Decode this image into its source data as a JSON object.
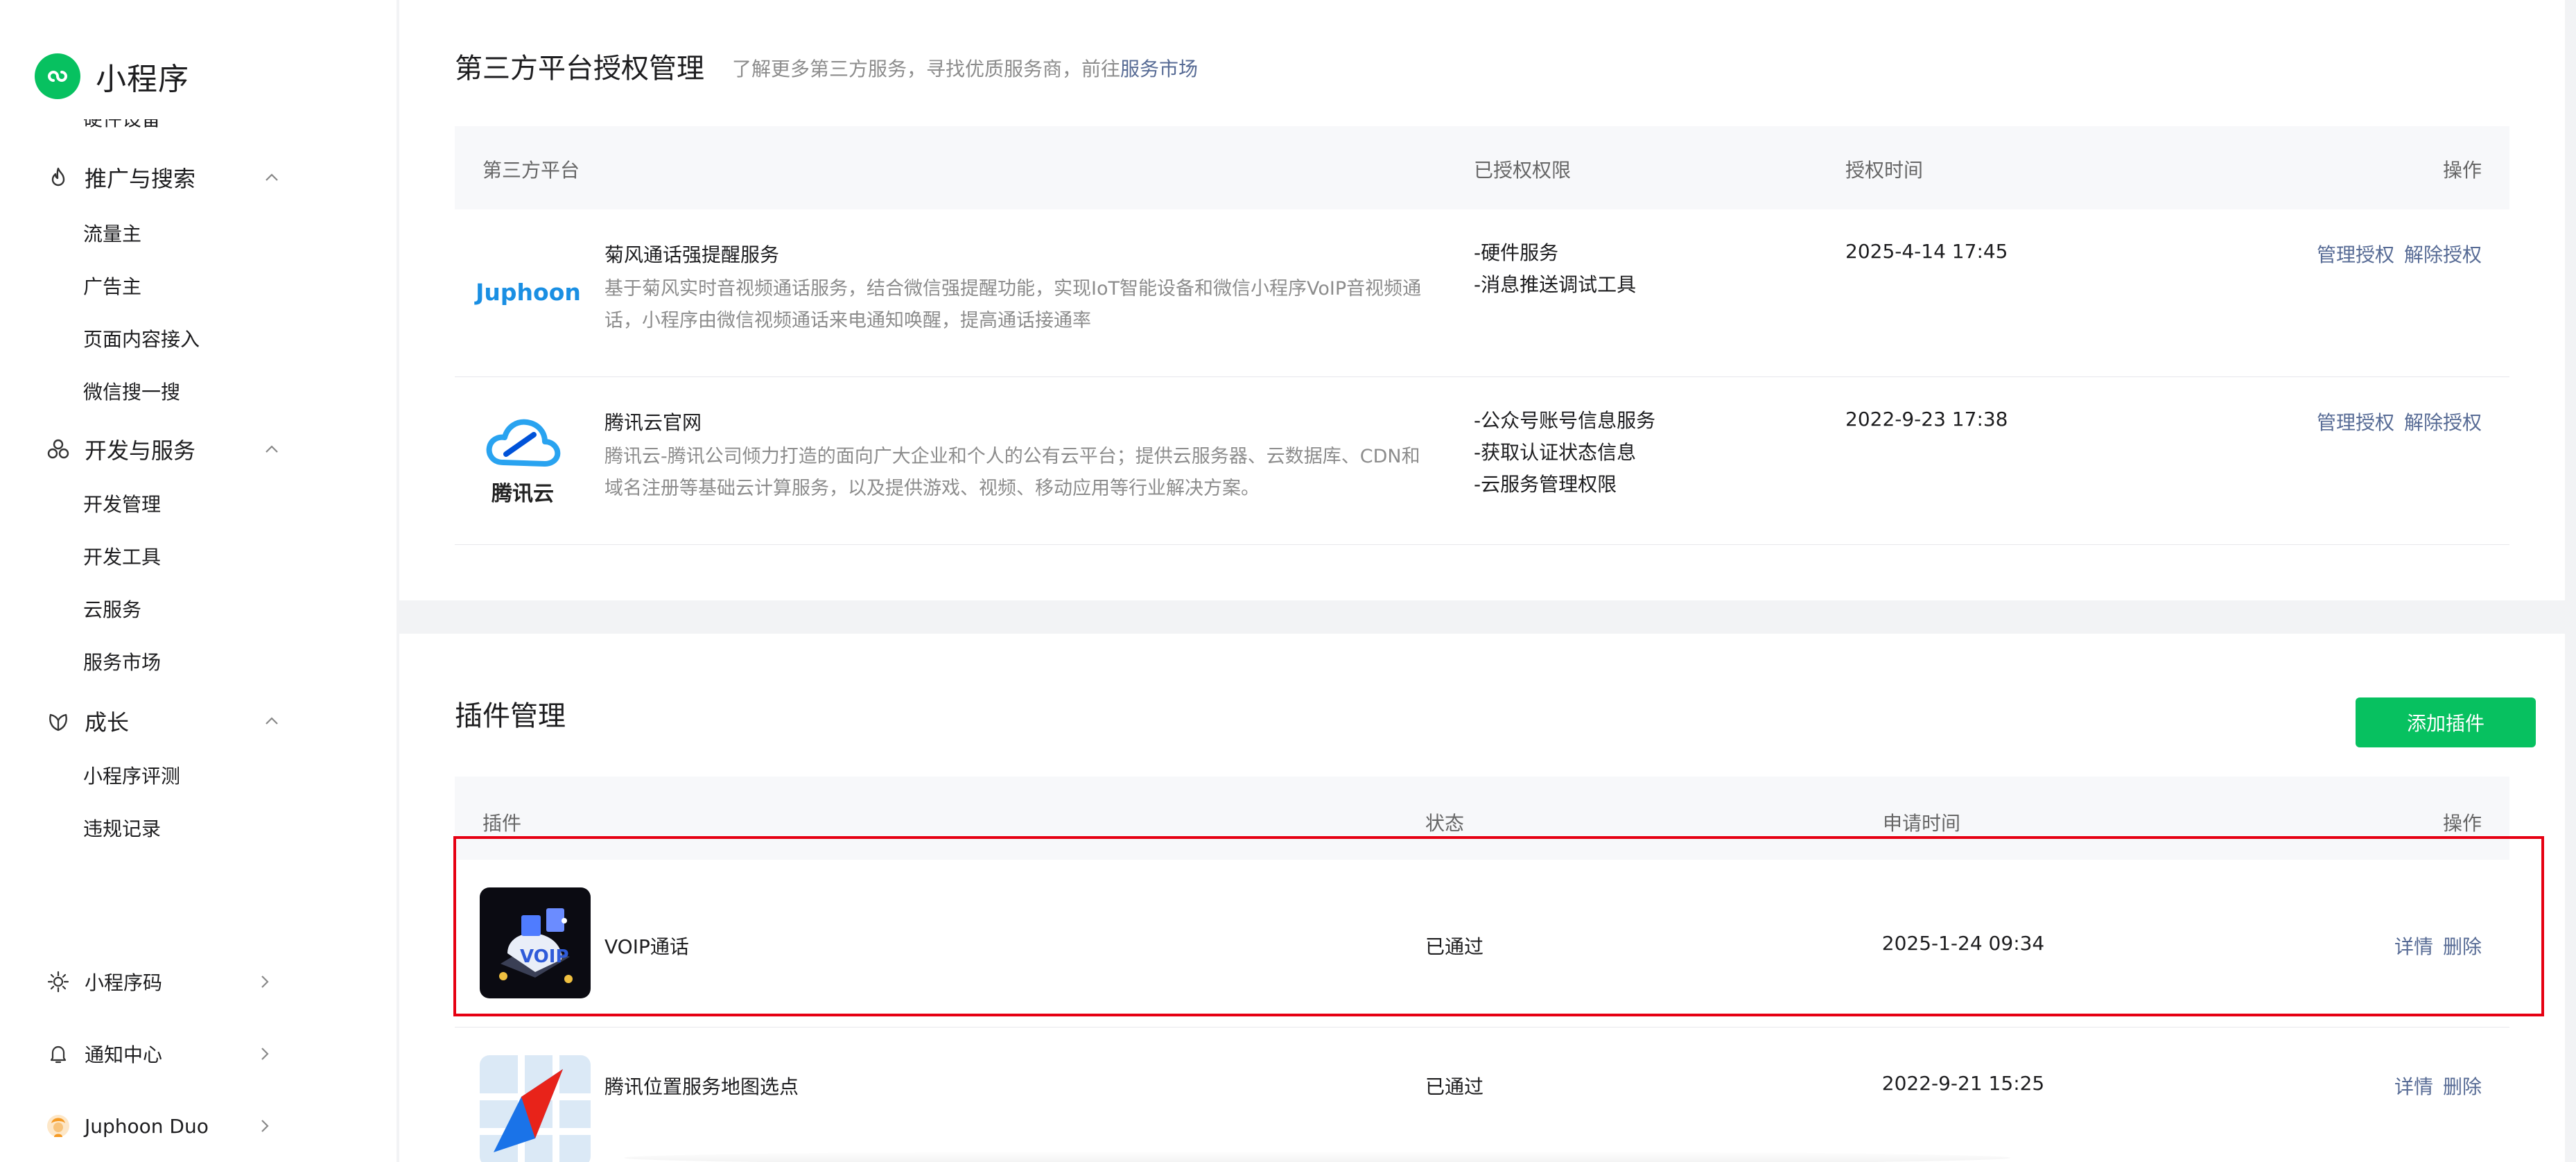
{
  "app": {
    "title": "小程序"
  },
  "sidebar": {
    "cut_item": "硬件设备",
    "groups": [
      {
        "label": "推广与搜索",
        "icon": "flame-icon",
        "items": [
          "流量主",
          "广告主",
          "页面内容接入",
          "微信搜一搜"
        ]
      },
      {
        "label": "开发与服务",
        "icon": "dev-services-icon",
        "items": [
          "开发管理",
          "开发工具",
          "云服务",
          "服务市场"
        ]
      },
      {
        "label": "成长",
        "icon": "growth-icon",
        "items": [
          "小程序评测",
          "违规记录"
        ]
      }
    ],
    "bottom": [
      {
        "label": "小程序码",
        "icon": "code-icon"
      },
      {
        "label": "通知中心",
        "icon": "bell-icon"
      },
      {
        "label": "Juphoon Duo",
        "icon": "avatar-icon"
      }
    ]
  },
  "third_party": {
    "title": "第三方平台授权管理",
    "subtitle": "了解更多第三方服务，寻找优质服务商，前往",
    "subtitle_link": "服务市场",
    "headers": {
      "platform": "第三方平台",
      "permissions": "已授权权限",
      "time": "授权时间",
      "ops": "操作"
    },
    "rows": [
      {
        "logo_text": "Juphoon",
        "name": "菊风通话强提醒服务",
        "desc": "基于菊风实时音视频通话服务，结合微信强提醒功能，实现IoT智能设备和微信小程序VoIP音视频通话，小程序由微信视频通话来电通知唤醒，提高通话接通率",
        "perms": [
          "-硬件服务",
          "-消息推送调试工具"
        ],
        "time": "2025-4-14 17:45",
        "op_manage": "管理授权",
        "op_revoke": "解除授权"
      },
      {
        "logo_text": "腾讯云",
        "name": "腾讯云官网",
        "desc": "腾讯云-腾讯公司倾力打造的面向广大企业和个人的公有云平台；提供云服务器、云数据库、CDN和域名注册等基础云计算服务，以及提供游戏、视频、移动应用等行业解决方案。",
        "perms": [
          "-公众号账号信息服务",
          "-获取认证状态信息",
          "-云服务管理权限"
        ],
        "time": "2022-9-23 17:38",
        "op_manage": "管理授权",
        "op_revoke": "解除授权"
      }
    ]
  },
  "plugins": {
    "title": "插件管理",
    "add_button": "添加插件",
    "headers": {
      "plugin": "插件",
      "status": "状态",
      "time": "申请时间",
      "ops": "操作"
    },
    "rows": [
      {
        "name": "VOIP通话",
        "status": "已通过",
        "time": "2025-1-24 09:34",
        "op_detail": "详情",
        "op_delete": "删除"
      },
      {
        "name": "腾讯位置服务地图选点",
        "status": "已通过",
        "time": "2022-9-21 15:25",
        "op_detail": "详情",
        "op_delete": "删除"
      }
    ]
  },
  "colors": {
    "brand": "#07c160",
    "link": "#576b95",
    "highlight": "#e60012",
    "juphoon": "#1a8fe3"
  }
}
